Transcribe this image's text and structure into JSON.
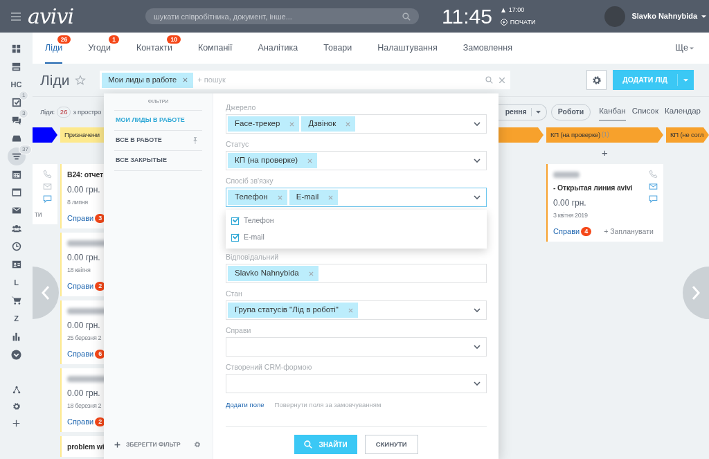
{
  "topbar": {
    "logo": "avivi",
    "search_placeholder": "шукати співробітника, документ, інше...",
    "clock": "11:45",
    "alarm": "17:00",
    "start": "ПОЧАТИ",
    "user": "Slavko Nahnybida"
  },
  "sidebar": {
    "items": [
      {
        "kind": "icon",
        "selected": false
      },
      {
        "kind": "icon",
        "selected": false
      },
      {
        "kind": "text",
        "label": "НС",
        "selected": false
      },
      {
        "kind": "icon",
        "badge": "1",
        "selected": false
      },
      {
        "kind": "icon",
        "badge": "3",
        "selected": false
      },
      {
        "kind": "icon",
        "selected": false
      },
      {
        "kind": "icon",
        "badge": "37",
        "selected": true
      },
      {
        "kind": "icon",
        "selected": false
      },
      {
        "kind": "icon",
        "selected": false
      },
      {
        "kind": "icon",
        "selected": false
      },
      {
        "kind": "icon",
        "selected": false
      },
      {
        "kind": "icon",
        "selected": false
      },
      {
        "kind": "icon",
        "selected": false
      },
      {
        "kind": "text",
        "label": "L",
        "selected": false
      },
      {
        "kind": "icon",
        "selected": false
      },
      {
        "kind": "text",
        "label": "Z",
        "selected": false
      },
      {
        "kind": "icon",
        "selected": false
      },
      {
        "kind": "icon",
        "selected": false
      }
    ],
    "bottom_items": [
      {
        "kind": "icon",
        "selected": false
      },
      {
        "kind": "icon",
        "selected": false
      },
      {
        "kind": "icon",
        "selected": false
      }
    ]
  },
  "tabs": [
    {
      "label": "Ліди",
      "badge": "26",
      "selected": true
    },
    {
      "label": "Угоди",
      "badge": "1",
      "selected": false
    },
    {
      "label": "Контакти",
      "badge": "10",
      "selected": false
    },
    {
      "label": "Компанії",
      "selected": false
    },
    {
      "label": "Аналітика",
      "selected": false
    },
    {
      "label": "Товари",
      "selected": false
    },
    {
      "label": "Налаштування",
      "selected": false
    },
    {
      "label": "Замовлення",
      "selected": false
    }
  ],
  "more_tab": "Ще",
  "page": {
    "title": "Ліди",
    "starred": false,
    "filter_chip": "Мои лиды в работе",
    "search_placeholder": "+ пошук",
    "add_button": "ДОДАТИ ЛІД"
  },
  "summary": {
    "label": "Ліди:",
    "count": "26",
    "text": "з простро"
  },
  "toolbar": {
    "split_button": "рення",
    "button": "Роботи",
    "views": [
      {
        "label": "Канбан",
        "selected": true
      },
      {
        "label": "Список",
        "selected": false
      },
      {
        "label": "Календар",
        "selected": false
      }
    ]
  },
  "kanban": {
    "columns": [
      {
        "color": "#0000ff",
        "cards": [
          {
            "channels": [
              {
                "active": false
              },
              {
                "active": false
              },
              {
                "active": true
              }
            ],
            "plan": "ти"
          }
        ]
      },
      {
        "title": "Призначени",
        "color": "#fde98d",
        "cards": [
          {
            "title": "B24: отчет",
            "amount": "0.00 грн.",
            "date": "8 липня",
            "activities": "Справи",
            "activity_count": "3"
          },
          {
            "redacted": true,
            "amount": "0.00 грн.",
            "date": "18 квітня",
            "activities": "Справи",
            "activity_count": "2"
          },
          {
            "redacted": true,
            "amount": "0.00 грн.",
            "date": "25 березня 2",
            "activities": "Справи",
            "activity_count": "6"
          },
          {
            "redacted": true,
            "amount": "0.00 грн.",
            "date": "18 березня 2",
            "activities": "Справи",
            "activity_count": "2"
          },
          {
            "title": "problem wi"
          }
        ]
      },
      {
        "color": "#f7a12c"
      },
      {
        "title": "КП (на проверке)",
        "count": "(1)",
        "color": "#f7a12c",
        "add": "+",
        "cards": [
          {
            "redacted": true,
            "title": "- Открытая линия avivi",
            "amount": "0.00 грн.",
            "date": "3 квітня 2019",
            "activities": "Справи",
            "activity_count": "4",
            "plan": "+ Запланувати",
            "channels": [
              {
                "active": false
              },
              {
                "active": true
              },
              {
                "active": true
              }
            ]
          }
        ]
      },
      {
        "title": "КП (не согл",
        "color": "#f7a12c"
      }
    ]
  },
  "filter": {
    "heading": "ФІЛЬТРИ",
    "presets": [
      {
        "label": "МОИ ЛИДЫ В РАБОТЕ",
        "selected": true,
        "pinned": false
      },
      {
        "label": "ВСЕ В РАБОТЕ",
        "selected": false,
        "pinned": true
      },
      {
        "label": "ВСЕ ЗАКРЫТЫЕ",
        "selected": false,
        "pinned": false
      }
    ],
    "save": "ЗБЕРЕГТИ ФІЛЬТР",
    "fields": [
      {
        "label": "Джерело",
        "chips": [
          "Face-трекер",
          "Дзвінок"
        ],
        "dropdown": true,
        "focused": false
      },
      {
        "label": "Статус",
        "chips": [
          "КП (на проверке)"
        ],
        "dropdown": true,
        "focused": false
      },
      {
        "label": "Спосіб зв'язку",
        "chips": [
          "Телефон",
          "E-mail"
        ],
        "dropdown": true,
        "focused": true,
        "options": [
          {
            "label": "Телефон",
            "checked": true
          },
          {
            "label": "E-mail",
            "checked": true
          }
        ]
      },
      {
        "label": "Відповідальний",
        "chips": [
          "Slavko Nahnybida"
        ],
        "dropdown": false,
        "focused": false
      },
      {
        "label": "Стан",
        "chips": [
          "Група статусів \"Лід в роботі\""
        ],
        "dropdown": true,
        "focused": false
      },
      {
        "label": "Справи",
        "dropdown": true,
        "focused": false
      },
      {
        "label": "Створений CRM-формою",
        "dropdown": true,
        "focused": false
      }
    ],
    "add_field": "Додати поле",
    "reset_fields": "Повернути поля за замовчуванням",
    "find": "ЗНАЙТИ",
    "reset": "СКИНУТИ"
  }
}
